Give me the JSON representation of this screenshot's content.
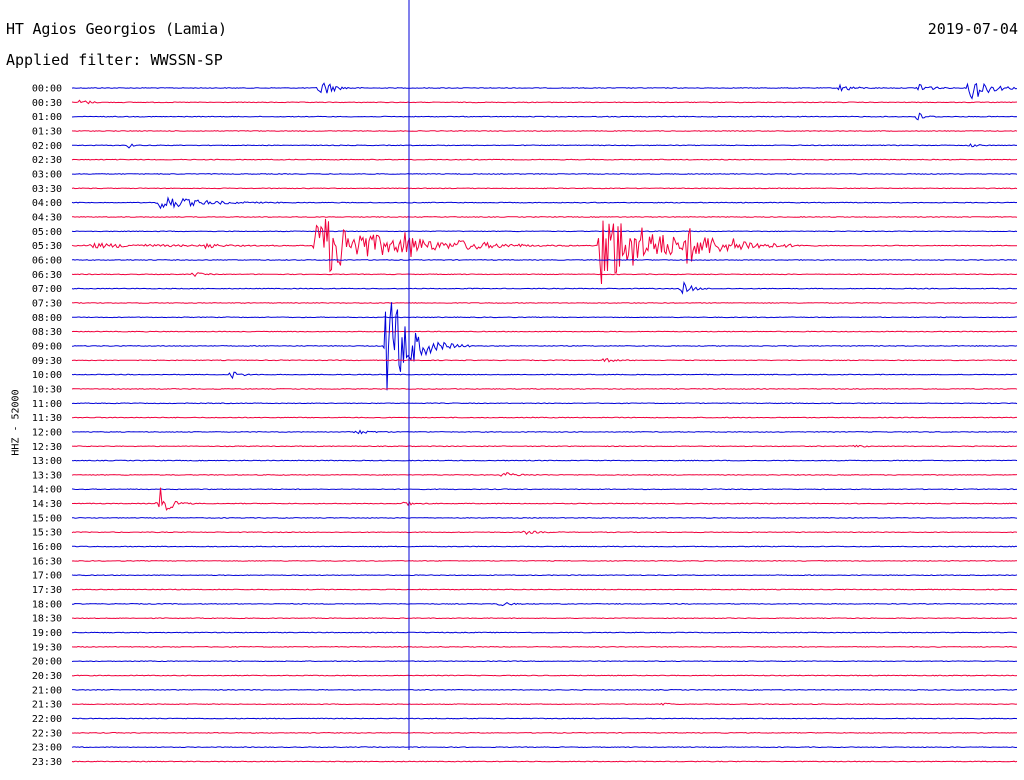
{
  "header": {
    "station": "HT Agios Georgios (Lamia)",
    "date": "2019-07-04",
    "filter": "Applied filter: WWSSN-SP",
    "channel": "HHZ - 52000"
  },
  "colors": {
    "trace_a": "#0000d8",
    "trace_b": "#f0003c"
  },
  "chart_data": {
    "type": "line",
    "title": "HT Agios Georgios (Lamia)",
    "subtitle": "Applied filter: WWSSN-SP",
    "date": "2019-07-04",
    "ylabel": "HHZ - 52000",
    "xlabel": "",
    "row_labels": [
      "00:00",
      "00:30",
      "01:00",
      "01:30",
      "02:00",
      "02:30",
      "03:00",
      "03:30",
      "04:00",
      "04:30",
      "05:00",
      "05:30",
      "06:00",
      "06:30",
      "07:00",
      "07:30",
      "08:00",
      "08:30",
      "09:00",
      "09:30",
      "10:00",
      "10:30",
      "11:00",
      "11:30",
      "12:00",
      "12:30",
      "13:00",
      "13:30",
      "14:00",
      "14:30",
      "15:00",
      "15:30",
      "16:00",
      "16:30",
      "17:00",
      "17:30",
      "18:00",
      "18:30",
      "19:00",
      "19:30",
      "20:00",
      "20:30",
      "21:00",
      "21:30",
      "22:00",
      "22:30",
      "23:00",
      "23:30"
    ],
    "row_colors": [
      "blue",
      "red"
    ],
    "x_range_minutes": [
      0,
      30
    ],
    "grid": false,
    "legend": "none",
    "events": [
      {
        "row": 0,
        "t": 7.9,
        "amp": 1.5,
        "dur": 0.6
      },
      {
        "row": 0,
        "t": 24.4,
        "amp": 0.6,
        "dur": 0.6
      },
      {
        "row": 0,
        "t": 26.9,
        "amp": 1.0,
        "dur": 0.5
      },
      {
        "row": 0,
        "t": 28.5,
        "amp": 2.0,
        "dur": 1.0
      },
      {
        "row": 1,
        "t": 0.3,
        "amp": 0.5,
        "dur": 0.4
      },
      {
        "row": 2,
        "t": 26.8,
        "amp": 0.7,
        "dur": 0.4
      },
      {
        "row": 4,
        "t": 1.8,
        "amp": 0.35,
        "dur": 0.2
      },
      {
        "row": 4,
        "t": 28.5,
        "amp": 0.3,
        "dur": 0.3
      },
      {
        "row": 8,
        "t": 2.8,
        "amp": 1.1,
        "dur": 2.0
      },
      {
        "row": 11,
        "t": 0.5,
        "amp": 0.35,
        "dur": 4.0
      },
      {
        "row": 11,
        "t": 4.2,
        "amp": 0.6,
        "dur": 0.5
      },
      {
        "row": 11,
        "t": 7.8,
        "amp": 5.0,
        "dur": 3.0
      },
      {
        "row": 11,
        "t": 10.5,
        "amp": 1.5,
        "dur": 1.0
      },
      {
        "row": 11,
        "t": 12.2,
        "amp": 0.5,
        "dur": 2.5
      },
      {
        "row": 11,
        "t": 16.8,
        "amp": 6.0,
        "dur": 3.0
      },
      {
        "row": 11,
        "t": 19.5,
        "amp": 1.8,
        "dur": 1.5
      },
      {
        "row": 11,
        "t": 21.0,
        "amp": 0.4,
        "dur": 1.5
      },
      {
        "row": 13,
        "t": 3.9,
        "amp": 0.3,
        "dur": 0.4
      },
      {
        "row": 14,
        "t": 19.4,
        "amp": 0.9,
        "dur": 0.5
      },
      {
        "row": 18,
        "t": 10.0,
        "amp": 9.0,
        "dur": 1.2
      },
      {
        "row": 19,
        "t": 16.9,
        "amp": 0.3,
        "dur": 0.6
      },
      {
        "row": 20,
        "t": 5.1,
        "amp": 0.6,
        "dur": 0.4
      },
      {
        "row": 24,
        "t": 9.0,
        "amp": 0.4,
        "dur": 0.6
      },
      {
        "row": 25,
        "t": 24.9,
        "amp": 0.3,
        "dur": 0.3
      },
      {
        "row": 27,
        "t": 13.7,
        "amp": 0.35,
        "dur": 0.8
      },
      {
        "row": 29,
        "t": 2.8,
        "amp": 2.3,
        "dur": 0.5
      },
      {
        "row": 29,
        "t": 10.5,
        "amp": 0.3,
        "dur": 0.6
      },
      {
        "row": 31,
        "t": 14.4,
        "amp": 0.25,
        "dur": 0.6
      },
      {
        "row": 36,
        "t": 13.6,
        "amp": 0.3,
        "dur": 0.5
      },
      {
        "row": 43,
        "t": 18.8,
        "amp": 0.3,
        "dur": 0.2
      }
    ]
  }
}
